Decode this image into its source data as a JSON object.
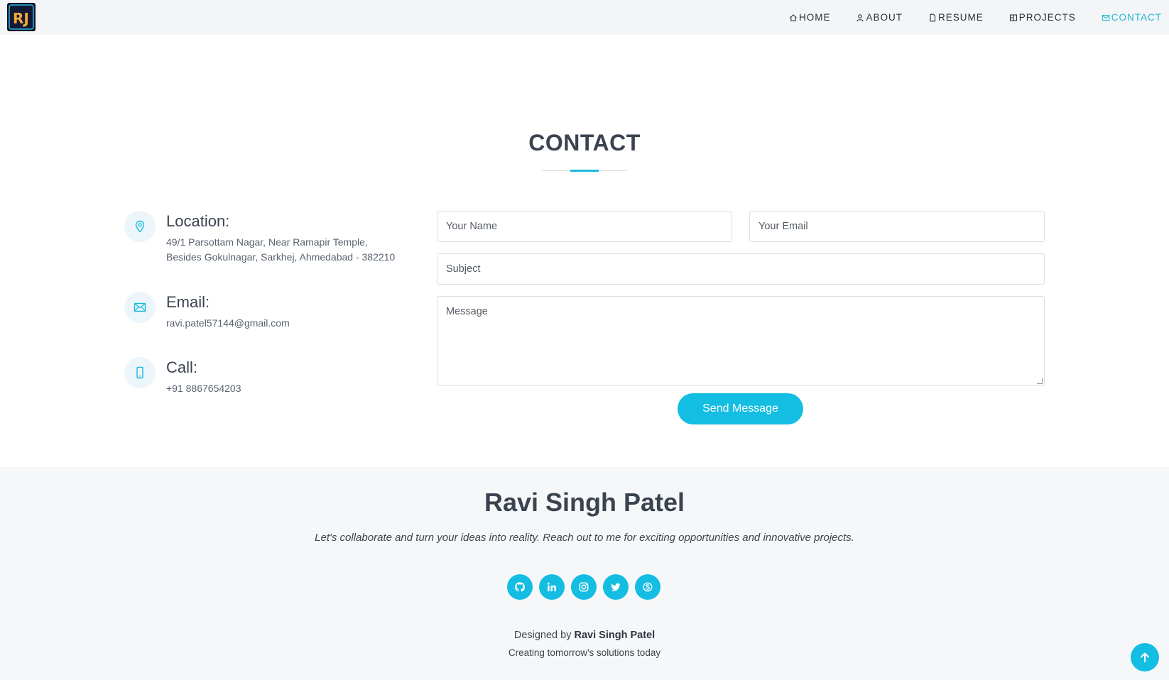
{
  "header": {
    "logo_text": "RJ",
    "nav": [
      {
        "label": "HOME",
        "icon": "house-icon"
      },
      {
        "label": "ABOUT",
        "icon": "person-icon"
      },
      {
        "label": "RESUME",
        "icon": "file-icon"
      },
      {
        "label": "PROJECTS",
        "icon": "grid-icon"
      },
      {
        "label": "CONTACT",
        "icon": "envelope-icon",
        "active": true
      }
    ]
  },
  "contact": {
    "title": "CONTACT",
    "location": {
      "title": "Location:",
      "line1": "49/1 Parsottam Nagar, Near Ramapir Temple,",
      "line2": "Besides Gokulnagar, Sarkhej, Ahmedabad - 382210"
    },
    "email": {
      "title": "Email:",
      "value": "ravi.patel57144@gmail.com"
    },
    "call": {
      "title": "Call:",
      "value": "+91 8867654203"
    }
  },
  "form": {
    "name_placeholder": "Your Name",
    "email_placeholder": "Your Email",
    "subject_placeholder": "Subject",
    "message_placeholder": "Message",
    "send_label": "Send Message"
  },
  "footer": {
    "name": "Ravi Singh Patel",
    "tagline": "Let's collaborate and turn your ideas into reality. Reach out to me for exciting opportunities and innovative projects.",
    "socials": [
      "github-icon",
      "linkedin-icon",
      "instagram-icon",
      "twitter-icon",
      "skype-icon"
    ],
    "designed_prefix": "Designed by",
    "designed_name": "Ravi Singh Patel",
    "subtitle": "Creating tomorrow's solutions today"
  },
  "colors": {
    "accent": "#14bde2",
    "heading": "#3b4350",
    "header_bg": "#f4f5f7",
    "footer_bg": "#f6f7f9"
  }
}
